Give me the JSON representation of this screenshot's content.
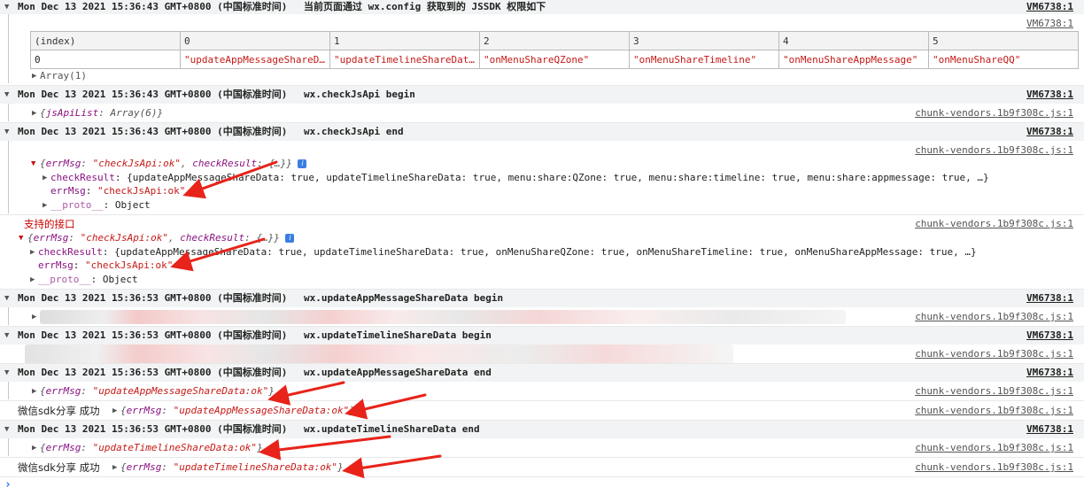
{
  "logs": {
    "g1": {
      "ts": "Mon Dec 13 2021 15:36:43 GMT+0800 (中国标准时间)",
      "msg": "当前页面通过 wx.config 获取到的 JSSDK 权限如下",
      "src": "VM6738:1",
      "src2": "VM6738:1"
    },
    "g2": {
      "ts": "Mon Dec 13 2021 15:36:43 GMT+0800 (中国标准时间)",
      "msg": "wx.checkJsApi begin",
      "src": "VM6738:1"
    },
    "g3": {
      "ts": "Mon Dec 13 2021 15:36:43 GMT+0800 (中国标准时间)",
      "msg": "wx.checkJsApi end",
      "src": "VM6738:1"
    },
    "g4": {
      "ts": "Mon Dec 13 2021 15:36:53 GMT+0800 (中国标准时间)",
      "msg": "wx.updateAppMessageShareData begin",
      "src": "VM6738:1"
    },
    "g5": {
      "ts": "Mon Dec 13 2021 15:36:53 GMT+0800 (中国标准时间)",
      "msg": "wx.updateTimelineShareData begin",
      "src": "VM6738:1"
    },
    "g6": {
      "ts": "Mon Dec 13 2021 15:36:53 GMT+0800 (中国标准时间)",
      "msg": "wx.updateAppMessageShareData end",
      "src": "VM6738:1"
    },
    "g7": {
      "ts": "Mon Dec 13 2021 15:36:53 GMT+0800 (中国标准时间)",
      "msg": "wx.updateTimelineShareData end",
      "src": "VM6738:1"
    }
  },
  "vendor_src": "chunk-vendors.1b9f308c.js:1",
  "table": {
    "headers": [
      "(index)",
      "0",
      "1",
      "2",
      "3",
      "4",
      "5"
    ],
    "row": [
      "0",
      "\"updateAppMessageShareD…",
      "\"updateTimelineShareDat…",
      "\"onMenuShareQZone\"",
      "\"onMenuShareTimeline\"",
      "\"onMenuShareAppMessage\"",
      "\"onMenuShareQQ\""
    ],
    "array_label": "Array(1)"
  },
  "jsapilist": {
    "key": "jsApiList",
    "val": "Array(6)"
  },
  "check1": {
    "summary_key1": "errMsg",
    "summary_val1": "\"checkJsApi:ok\"",
    "summary_key2": "checkResult",
    "summary_val2": "{…}",
    "cr_key": "checkResult",
    "cr_text": "{updateAppMessageShareData: true, updateTimelineShareData: true, menu:share:QZone: true, menu:share:timeline: true, menu:share:appmessage: true, …}",
    "err_key": "errMsg",
    "err_val": "\"checkJsApi:ok\"",
    "proto_key": "__proto__",
    "proto_val": "Object"
  },
  "check2_label": "支持的接口",
  "check2": {
    "summary_key1": "errMsg",
    "summary_val1": "\"checkJsApi:ok\"",
    "summary_key2": "checkResult",
    "summary_val2": "{…}",
    "cr_key": "checkResult",
    "cr_text": "{updateAppMessageShareData: true, updateTimelineShareData: true, onMenuShareQZone: true, onMenuShareTimeline: true, onMenuShareAppMessage: true, …}",
    "err_key": "errMsg",
    "err_val": "\"checkJsApi:ok\"",
    "proto_key": "__proto__",
    "proto_val": "Object"
  },
  "share1": {
    "key": "errMsg",
    "val": "\"updateAppMessageShareData:ok\""
  },
  "share1b": {
    "label": "微信sdk分享 成功",
    "key": "errMsg",
    "val": "\"updateAppMessageShareData:ok\""
  },
  "share2": {
    "key": "errMsg",
    "val": "\"updateTimelineShareData:ok\""
  },
  "share2b": {
    "label": "微信sdk分享 成功",
    "key": "errMsg",
    "val": "\"updateTimelineShareData:ok\""
  },
  "info_badge": "i",
  "prompt": "›",
  "colors": {
    "arrow": "#e8231a",
    "string": "#c41a16",
    "keyword": "#1a1aa6",
    "property": "#881280"
  }
}
